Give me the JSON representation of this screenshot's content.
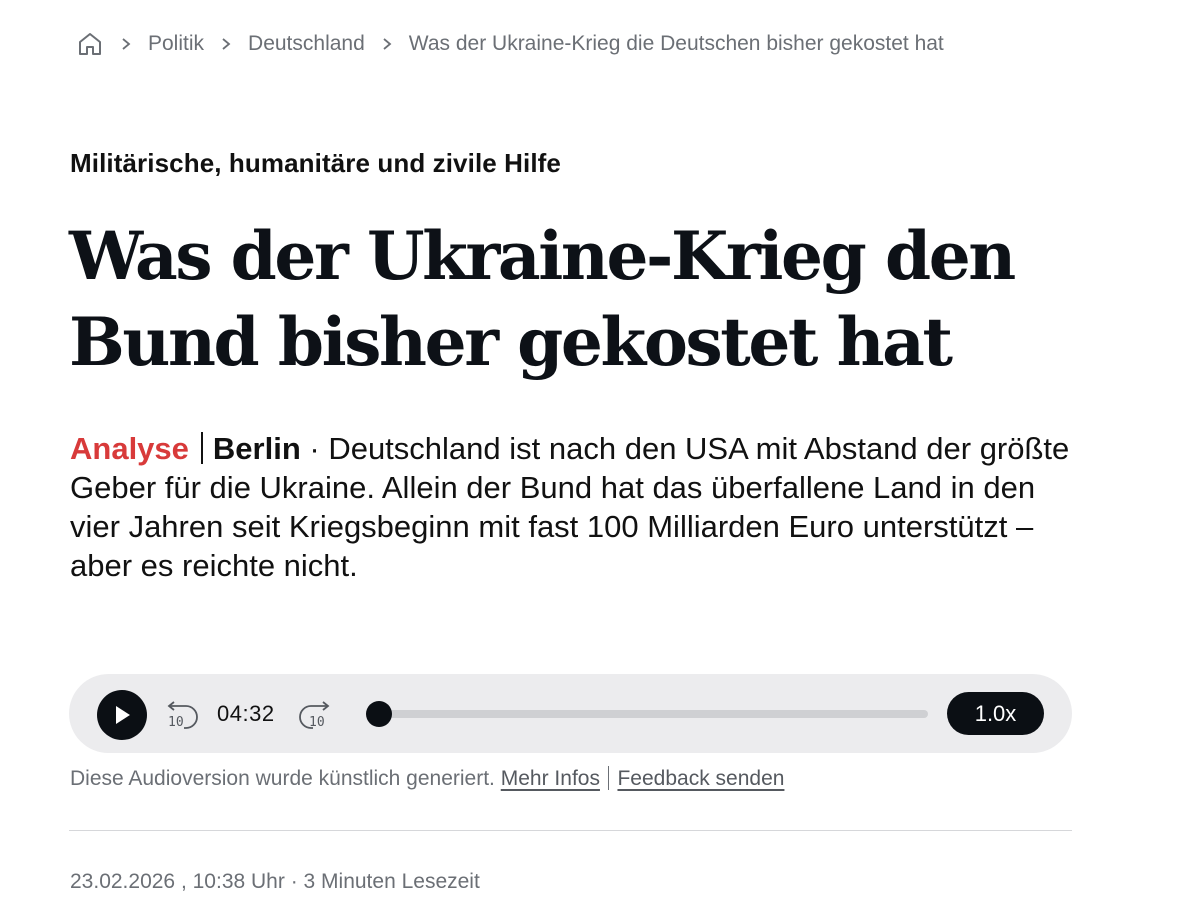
{
  "breadcrumb": {
    "home_icon": "home-icon",
    "separator_icon": "chevron-right-icon",
    "items": [
      {
        "label": "Politik"
      },
      {
        "label": "Deutschland"
      },
      {
        "label": "Was der Ukraine-Krieg die Deutschen bisher gekostet hat"
      }
    ]
  },
  "article": {
    "kicker": "Militärische, humanitäre und zivile Hilfe",
    "headline": "Was der Ukraine-Krieg den Bund bisher gekostet hat",
    "teaser": {
      "type": "Analyse",
      "location": "Berlin",
      "text": " · Deutschland ist nach den USA mit Abstand der größte Geber für die Ukraine. Allein der Bund hat das überfallene Land in den vier Jahren seit Kriegsbeginn mit fast 100 Milliarden Euro unterstützt – aber es reichte nicht."
    }
  },
  "audio_player": {
    "play_icon": "play-icon",
    "rewind_label": "10",
    "forward_label": "10",
    "time": "04:32",
    "progress": 0.0,
    "speed": "1.0x"
  },
  "audio_note": {
    "text": "Diese Audioversion wurde künstlich generiert.",
    "more_info_link": "Mehr Infos",
    "feedback_link": "Feedback senden"
  },
  "meta": {
    "date": "23.02.2026",
    "time": "10:38 Uhr",
    "reading_time": "3 Minuten Lesezeit"
  },
  "colors": {
    "accent_red": "#d83a3a",
    "dark": "#0b0f14",
    "muted_text": "#6b6f75",
    "player_bg": "#ececee"
  }
}
